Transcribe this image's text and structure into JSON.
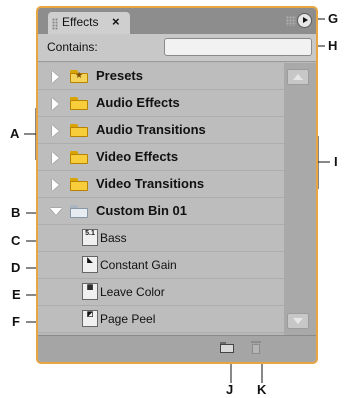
{
  "panel": {
    "tab_label": "Effects",
    "close_glyph": "×",
    "contains_label": "Contains:",
    "search_value": "",
    "search_placeholder": ""
  },
  "rows": [
    {
      "label": "Presets",
      "kind": "folder",
      "icon": "presets-folder-icon",
      "expanded": false
    },
    {
      "label": "Audio Effects",
      "kind": "folder",
      "icon": "folder-icon",
      "expanded": false
    },
    {
      "label": "Audio Transitions",
      "kind": "folder",
      "icon": "folder-icon",
      "expanded": false
    },
    {
      "label": "Video Effects",
      "kind": "folder",
      "icon": "folder-icon",
      "expanded": false
    },
    {
      "label": "Video Transitions",
      "kind": "folder",
      "icon": "folder-icon",
      "expanded": false
    },
    {
      "label": "Custom Bin 01",
      "kind": "bin",
      "icon": "bin-icon",
      "expanded": true
    },
    {
      "label": "Bass",
      "kind": "effect",
      "icon": "audio-effect-icon",
      "icon_text": "5.1"
    },
    {
      "label": "Constant Gain",
      "kind": "effect",
      "icon": "audio-transition-icon",
      "icon_text": "◣"
    },
    {
      "label": "Leave Color",
      "kind": "effect",
      "icon": "video-effect-icon",
      "icon_text": "▦"
    },
    {
      "label": "Page Peel",
      "kind": "effect",
      "icon": "video-transition-icon",
      "icon_text": "◩"
    }
  ],
  "footer": {
    "new_bin_icon": "new-bin-icon",
    "delete_icon": "trash-icon"
  },
  "callouts": {
    "A": "A",
    "B": "B",
    "C": "C",
    "D": "D",
    "E": "E",
    "F": "F",
    "G": "G",
    "H": "H",
    "I": "I",
    "J": "J",
    "K": "K"
  },
  "colors": {
    "panel_border": "#e8a640",
    "folder": "#f7cd3c",
    "panel_bg": "#b9b9b9"
  }
}
